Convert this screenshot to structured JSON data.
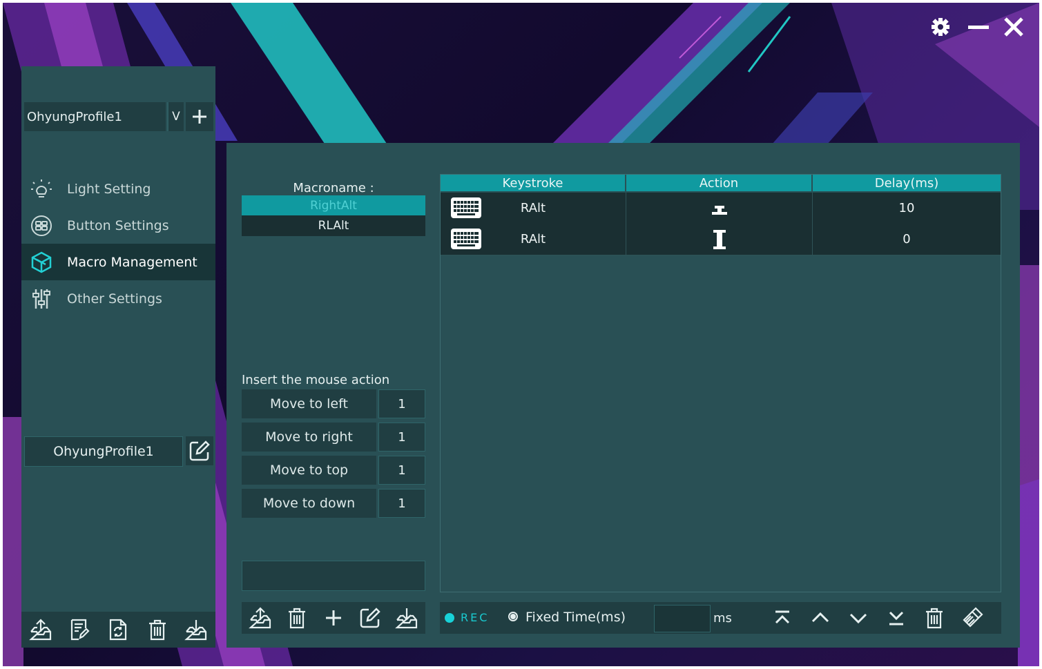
{
  "window": {
    "settings_icon": "gear-icon",
    "minimize_icon": "minus-icon",
    "close_icon": "close-x-icon"
  },
  "sidebar": {
    "profile_select": {
      "value": "OhyungProfile1",
      "dropdown_glyph": "V"
    },
    "nav": [
      {
        "label": "Light Setting",
        "icon": "light-bulb-icon",
        "active": false
      },
      {
        "label": "Button Settings",
        "icon": "gamepad-buttons-icon",
        "active": false
      },
      {
        "label": "Macro Management",
        "icon": "cube-icon",
        "active": true
      },
      {
        "label": "Other Settings",
        "icon": "sliders-icon",
        "active": false
      }
    ],
    "profile_name": "OhyungProfile1",
    "footer_icons": [
      "export-icon",
      "notes-icon",
      "reset-file-icon",
      "delete-icon",
      "import-icon"
    ]
  },
  "macro": {
    "name_label": "Macroname :",
    "list": [
      "RightAlt",
      "RLAlt"
    ],
    "selected": "RightAlt",
    "mouse_title": "Insert the mouse action",
    "mouse_actions": [
      {
        "label": "Move to left",
        "value": "1"
      },
      {
        "label": "Move to right",
        "value": "1"
      },
      {
        "label": "Move to top",
        "value": "1"
      },
      {
        "label": "Move to down",
        "value": "1"
      }
    ],
    "name_input_value": "",
    "footer_icons": [
      "export-icon",
      "delete-icon",
      "add-icon",
      "edit-icon",
      "import-icon"
    ]
  },
  "table": {
    "columns": [
      "Keystroke",
      "Action",
      "Delay(ms)"
    ],
    "rows": [
      {
        "key": "RAlt",
        "action": "key-up-icon",
        "delay": "10"
      },
      {
        "key": "RAlt",
        "action": "key-down-icon",
        "delay": "0"
      }
    ]
  },
  "bottom": {
    "rec_label": "REC",
    "fixed_time_label": "Fixed Time(ms)",
    "fixed_time_value": "",
    "ms_label": "ms",
    "icons": [
      "move-top-icon",
      "move-up-icon",
      "move-down-icon",
      "move-bottom-icon",
      "delete-icon",
      "clear-icon"
    ]
  },
  "colors": {
    "panel": "#295055",
    "panel_dark": "#203e42",
    "accent": "#109aa0",
    "rec": "#18d2d8"
  }
}
